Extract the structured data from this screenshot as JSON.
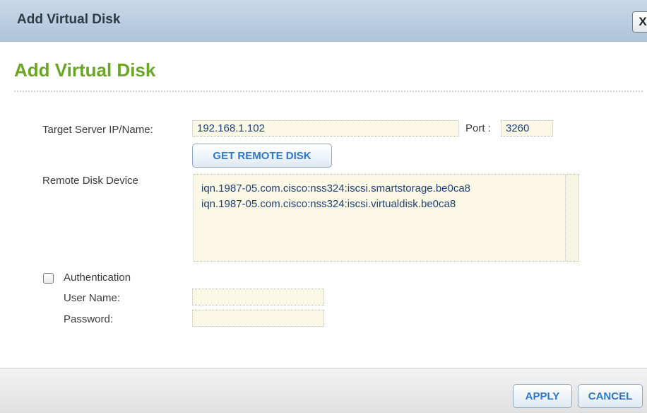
{
  "dialog": {
    "window_title": "Add Virtual Disk",
    "close_label": "X",
    "heading": "Add Virtual Disk"
  },
  "form": {
    "target_label": "Target Server IP/Name:",
    "target_value": "192.168.1.102",
    "port_label": "Port :",
    "port_value": "3260",
    "get_remote_disk_label": "GET REMOTE DISK",
    "remote_disk_label": "Remote Disk Device",
    "remote_disks": [
      "iqn.1987-05.com.cisco:nss324:iscsi.smartstorage.be0ca8",
      "iqn.1987-05.com.cisco:nss324:iscsi.virtualdisk.be0ca8"
    ],
    "authentication_label": "Authentication",
    "authentication_checked": false,
    "username_label": "User Name:",
    "username_value": "",
    "password_label": "Password:",
    "password_value": ""
  },
  "footer": {
    "apply_label": "APPLY",
    "cancel_label": "CANCEL"
  }
}
